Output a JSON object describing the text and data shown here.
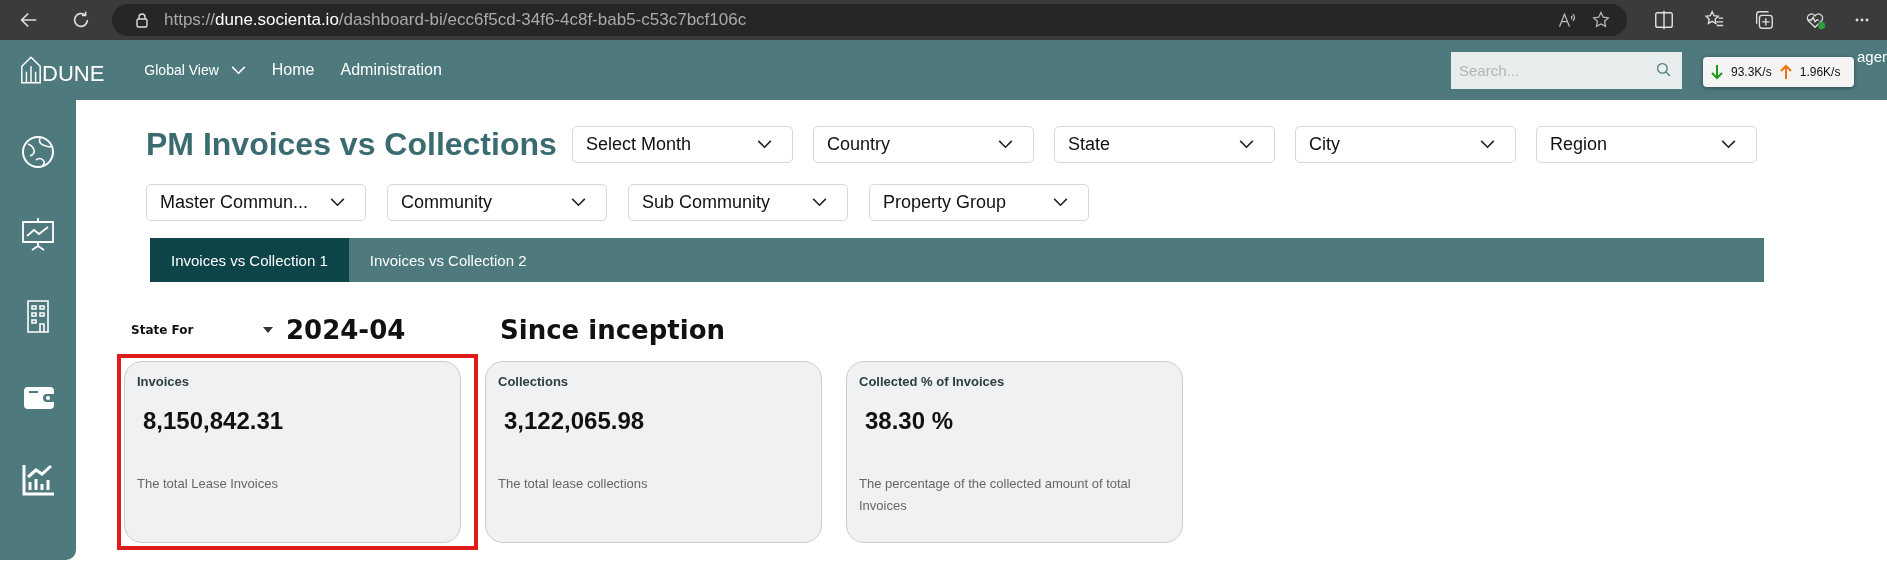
{
  "browser": {
    "url_scheme": "https://",
    "url_host": "dune.socienta.io",
    "url_path": "/dashboard-bi/ecc6f5cd-34f6-4c8f-bab5-c53c7bcf106c"
  },
  "app_bar": {
    "logo": "DUNE",
    "nav": [
      {
        "label": "Global View",
        "kind": "dropdown"
      },
      {
        "label": "Home",
        "kind": "link"
      },
      {
        "label": "Administration",
        "kind": "link"
      }
    ],
    "search": {
      "placeholder": "Search..."
    },
    "user_fragment": "ager"
  },
  "network_meter": {
    "download": "93.3K/s",
    "upload": "1.96K/s"
  },
  "sidebar": {
    "items": [
      {
        "kind": "globe"
      },
      {
        "kind": "presentation"
      },
      {
        "kind": "building"
      },
      {
        "kind": "wallet"
      },
      {
        "kind": "chart"
      }
    ]
  },
  "page_title": "PM Invoices vs Collections",
  "filters": [
    {
      "label": "Select Month"
    },
    {
      "label": "Country"
    },
    {
      "label": "State"
    },
    {
      "label": "City"
    },
    {
      "label": "Region"
    },
    {
      "label": "Master Commun..."
    },
    {
      "label": "Community"
    },
    {
      "label": "Sub Community"
    },
    {
      "label": "Property Group"
    }
  ],
  "tabs": [
    {
      "label": "Invoices vs Collection 1",
      "selected": true
    },
    {
      "label": "Invoices vs Collection 2",
      "selected": false
    }
  ],
  "state_for": {
    "label": "State For",
    "period": "2024-04",
    "scope": "Since inception"
  },
  "cards": [
    {
      "title": "Invoices",
      "value": "8,150,842.31",
      "description": "The total Lease Invoices",
      "highlighted": true
    },
    {
      "title": "Collections",
      "value": "3,122,065.98",
      "description": "The total lease collections",
      "highlighted": false
    },
    {
      "title": "Collected % of Invoices",
      "value": "38.30 %",
      "description": "The percentage of the collected amount of total Invoices",
      "highlighted": false
    }
  ]
}
